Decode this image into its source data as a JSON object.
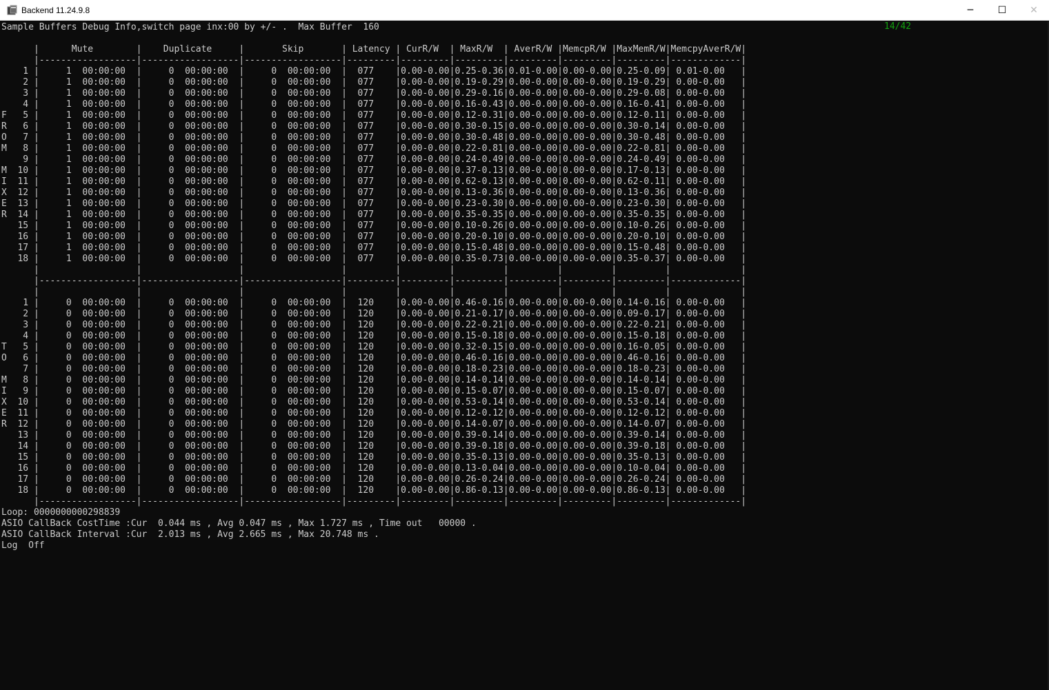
{
  "window": {
    "title": "Backend 11.24.9.8",
    "minimize_glyph": "─",
    "maximize_glyph": "☐",
    "close_glyph": "✕"
  },
  "console": {
    "page_indicator": "14/42",
    "lines": [
      "Sample Buffers Debug Info,switch page inx:00 by +/- .  Max Buffer  160",
      "",
      "      |      Mute        |    Duplicate     |       Skip       | Latency | CurR/W  | MaxR/W  | AverR/W |MemcpR/W |MaxMemR/W|MemcpyAverR/W|",
      "      |------------------|------------------|------------------|---------|---------|---------|---------|---------|---------|-------------|",
      "    1 |     1  00:00:00  |     0  00:00:00  |     0  00:00:00  |  077    |0.00-0.00|0.25-0.36|0.01-0.00|0.00-0.00|0.25-0.09| 0.01-0.00   |",
      "    2 |     1  00:00:00  |     0  00:00:00  |     0  00:00:00  |  077    |0.00-0.00|0.19-0.29|0.00-0.00|0.00-0.00|0.19-0.29| 0.00-0.00   |",
      "    3 |     1  00:00:00  |     0  00:00:00  |     0  00:00:00  |  077    |0.00-0.00|0.29-0.16|0.00-0.00|0.00-0.00|0.29-0.08| 0.00-0.00   |",
      "    4 |     1  00:00:00  |     0  00:00:00  |     0  00:00:00  |  077    |0.00-0.00|0.16-0.43|0.00-0.00|0.00-0.00|0.16-0.41| 0.00-0.00   |",
      "F   5 |     1  00:00:00  |     0  00:00:00  |     0  00:00:00  |  077    |0.00-0.00|0.12-0.31|0.00-0.00|0.00-0.00|0.12-0.11| 0.00-0.00   |",
      "R   6 |     1  00:00:00  |     0  00:00:00  |     0  00:00:00  |  077    |0.00-0.00|0.30-0.15|0.00-0.00|0.00-0.00|0.30-0.14| 0.00-0.00   |",
      "O   7 |     1  00:00:00  |     0  00:00:00  |     0  00:00:00  |  077    |0.00-0.00|0.30-0.48|0.00-0.00|0.00-0.00|0.30-0.48| 0.00-0.00   |",
      "M   8 |     1  00:00:00  |     0  00:00:00  |     0  00:00:00  |  077    |0.00-0.00|0.22-0.81|0.00-0.00|0.00-0.00|0.22-0.81| 0.00-0.00   |",
      "    9 |     1  00:00:00  |     0  00:00:00  |     0  00:00:00  |  077    |0.00-0.00|0.24-0.49|0.00-0.00|0.00-0.00|0.24-0.49| 0.00-0.00   |",
      "M  10 |     1  00:00:00  |     0  00:00:00  |     0  00:00:00  |  077    |0.00-0.00|0.37-0.13|0.00-0.00|0.00-0.00|0.17-0.13| 0.00-0.00   |",
      "I  11 |     1  00:00:00  |     0  00:00:00  |     0  00:00:00  |  077    |0.00-0.00|0.62-0.13|0.00-0.00|0.00-0.00|0.62-0.11| 0.00-0.00   |",
      "X  12 |     1  00:00:00  |     0  00:00:00  |     0  00:00:00  |  077    |0.00-0.00|0.13-0.36|0.00-0.00|0.00-0.00|0.13-0.36| 0.00-0.00   |",
      "E  13 |     1  00:00:00  |     0  00:00:00  |     0  00:00:00  |  077    |0.00-0.00|0.23-0.30|0.00-0.00|0.00-0.00|0.23-0.30| 0.00-0.00   |",
      "R  14 |     1  00:00:00  |     0  00:00:00  |     0  00:00:00  |  077    |0.00-0.00|0.35-0.35|0.00-0.00|0.00-0.00|0.35-0.35| 0.00-0.00   |",
      "   15 |     1  00:00:00  |     0  00:00:00  |     0  00:00:00  |  077    |0.00-0.00|0.10-0.26|0.00-0.00|0.00-0.00|0.10-0.26| 0.00-0.00   |",
      "   16 |     1  00:00:00  |     0  00:00:00  |     0  00:00:00  |  077    |0.00-0.00|0.20-0.10|0.00-0.00|0.00-0.00|0.20-0.10| 0.00-0.00   |",
      "   17 |     1  00:00:00  |     0  00:00:00  |     0  00:00:00  |  077    |0.00-0.00|0.15-0.48|0.00-0.00|0.00-0.00|0.15-0.48| 0.00-0.00   |",
      "   18 |     1  00:00:00  |     0  00:00:00  |     0  00:00:00  |  077    |0.00-0.00|0.35-0.73|0.00-0.00|0.00-0.00|0.35-0.37| 0.00-0.00   |",
      "      |                  |                  |                  |         |         |         |         |         |         |             |",
      "      |------------------|------------------|------------------|---------|---------|---------|---------|---------|---------|-------------|",
      "      |                  |                  |                  |         |         |         |         |         |         |             |",
      "    1 |     0  00:00:00  |     0  00:00:00  |     0  00:00:00  |  120    |0.00-0.00|0.46-0.16|0.00-0.00|0.00-0.00|0.14-0.16| 0.00-0.00   |",
      "    2 |     0  00:00:00  |     0  00:00:00  |     0  00:00:00  |  120    |0.00-0.00|0.21-0.17|0.00-0.00|0.00-0.00|0.09-0.17| 0.00-0.00   |",
      "    3 |     0  00:00:00  |     0  00:00:00  |     0  00:00:00  |  120    |0.00-0.00|0.22-0.21|0.00-0.00|0.00-0.00|0.22-0.21| 0.00-0.00   |",
      "    4 |     0  00:00:00  |     0  00:00:00  |     0  00:00:00  |  120    |0.00-0.00|0.15-0.18|0.00-0.00|0.00-0.00|0.15-0.18| 0.00-0.00   |",
      "T   5 |     0  00:00:00  |     0  00:00:00  |     0  00:00:00  |  120    |0.00-0.00|0.32-0.15|0.00-0.00|0.00-0.00|0.16-0.05| 0.00-0.00   |",
      "O   6 |     0  00:00:00  |     0  00:00:00  |     0  00:00:00  |  120    |0.00-0.00|0.46-0.16|0.00-0.00|0.00-0.00|0.46-0.16| 0.00-0.00   |",
      "    7 |     0  00:00:00  |     0  00:00:00  |     0  00:00:00  |  120    |0.00-0.00|0.18-0.23|0.00-0.00|0.00-0.00|0.18-0.23| 0.00-0.00   |",
      "M   8 |     0  00:00:00  |     0  00:00:00  |     0  00:00:00  |  120    |0.00-0.00|0.14-0.14|0.00-0.00|0.00-0.00|0.14-0.14| 0.00-0.00   |",
      "I   9 |     0  00:00:00  |     0  00:00:00  |     0  00:00:00  |  120    |0.00-0.00|0.15-0.07|0.00-0.00|0.00-0.00|0.15-0.07| 0.00-0.00   |",
      "X  10 |     0  00:00:00  |     0  00:00:00  |     0  00:00:00  |  120    |0.00-0.00|0.53-0.14|0.00-0.00|0.00-0.00|0.53-0.14| 0.00-0.00   |",
      "E  11 |     0  00:00:00  |     0  00:00:00  |     0  00:00:00  |  120    |0.00-0.00|0.12-0.12|0.00-0.00|0.00-0.00|0.12-0.12| 0.00-0.00   |",
      "R  12 |     0  00:00:00  |     0  00:00:00  |     0  00:00:00  |  120    |0.00-0.00|0.14-0.07|0.00-0.00|0.00-0.00|0.14-0.07| 0.00-0.00   |",
      "   13 |     0  00:00:00  |     0  00:00:00  |     0  00:00:00  |  120    |0.00-0.00|0.39-0.14|0.00-0.00|0.00-0.00|0.39-0.14| 0.00-0.00   |",
      "   14 |     0  00:00:00  |     0  00:00:00  |     0  00:00:00  |  120    |0.00-0.00|0.39-0.18|0.00-0.00|0.00-0.00|0.39-0.18| 0.00-0.00   |",
      "   15 |     0  00:00:00  |     0  00:00:00  |     0  00:00:00  |  120    |0.00-0.00|0.35-0.13|0.00-0.00|0.00-0.00|0.35-0.13| 0.00-0.00   |",
      "   16 |     0  00:00:00  |     0  00:00:00  |     0  00:00:00  |  120    |0.00-0.00|0.13-0.04|0.00-0.00|0.00-0.00|0.10-0.04| 0.00-0.00   |",
      "   17 |     0  00:00:00  |     0  00:00:00  |     0  00:00:00  |  120    |0.00-0.00|0.26-0.24|0.00-0.00|0.00-0.00|0.26-0.24| 0.00-0.00   |",
      "   18 |     0  00:00:00  |     0  00:00:00  |     0  00:00:00  |  120    |0.00-0.00|0.86-0.13|0.00-0.00|0.00-0.00|0.86-0.13| 0.00-0.00   |",
      "      |------------------|------------------|------------------|---------|---------|---------|---------|---------|---------|-------------|",
      "Loop: 0000000000298839",
      "ASIO CallBack CostTime :Cur  0.044 ms , Avg 0.047 ms , Max 1.727 ms , Time out   00000 .",
      "ASIO CallBack Interval :Cur  2.013 ms , Avg 2.665 ms , Max 20.748 ms .",
      "Log  Off"
    ]
  },
  "colors": {
    "console_background": "#0c0c0c",
    "console_text": "#cccccc",
    "page_indicator": "#13a10e",
    "titlebar_background": "#ffffff"
  }
}
